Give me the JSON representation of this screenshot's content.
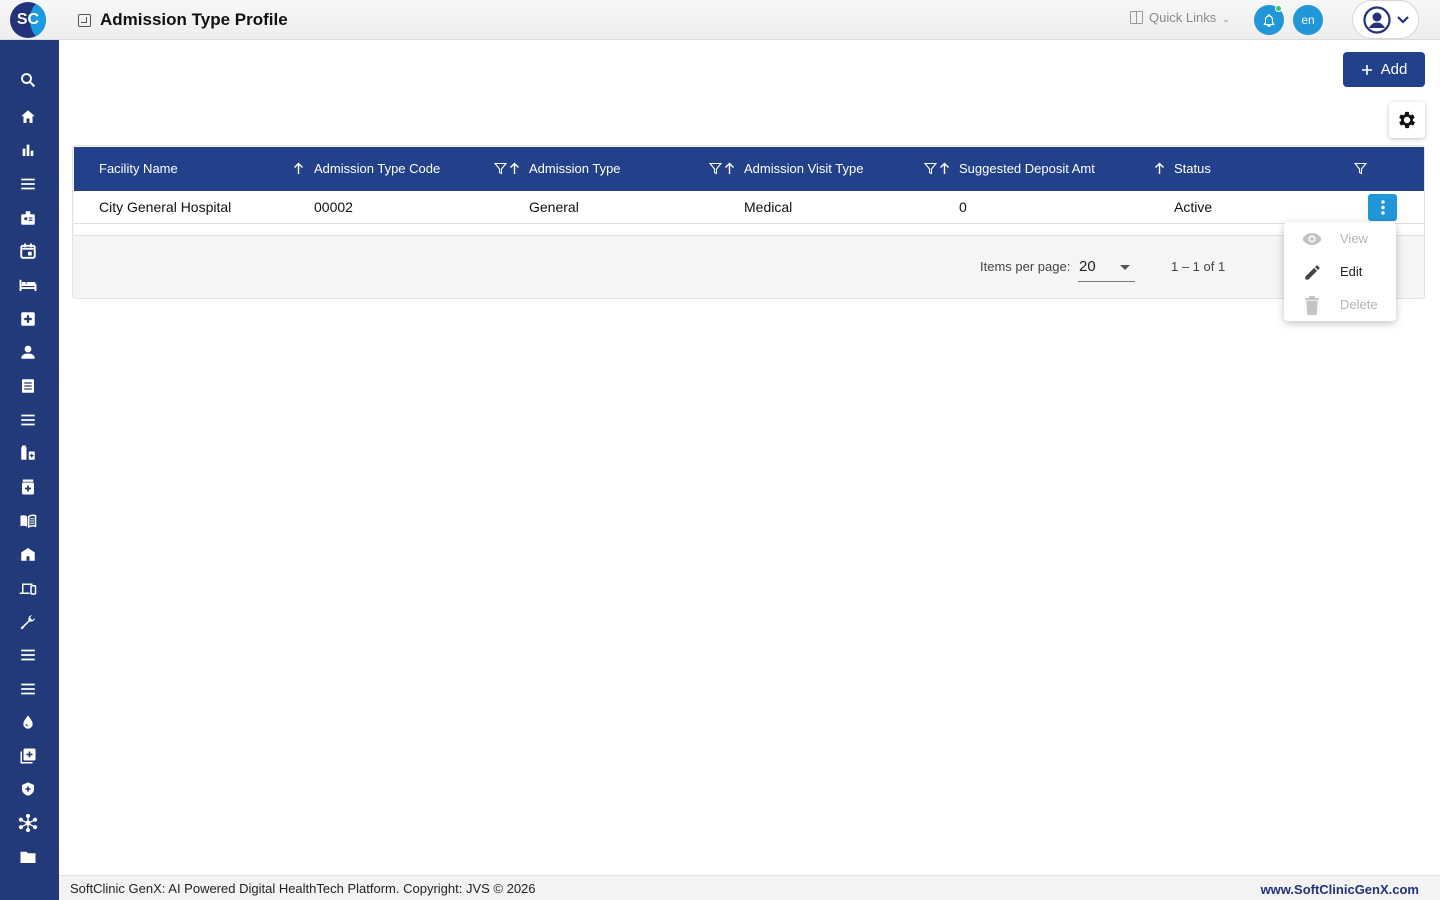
{
  "header": {
    "logo_s": "S",
    "logo_c": "C",
    "title": "Admission Type Profile",
    "quick_links": "Quick Links",
    "language": "en"
  },
  "toolbar": {
    "add_label": "Add"
  },
  "table": {
    "columns": [
      "Facility Name",
      "Admission Type Code",
      "Admission Type",
      "Admission Visit Type",
      "Suggested Deposit Amt",
      "Status"
    ],
    "rows": [
      [
        "City General Hospital",
        "00002",
        "General",
        "Medical",
        "0",
        "Active"
      ]
    ]
  },
  "pagination": {
    "items_per_page_label": "Items per page:",
    "items_per_page_value": "20",
    "range": "1 – 1 of 1"
  },
  "row_menu": {
    "view": "View",
    "edit": "Edit",
    "delete": "Delete"
  },
  "footer": {
    "copyright": "SoftClinic GenX: AI Powered Digital HealthTech Platform. Copyright: JVS © 2026",
    "website": "www.SoftClinicGenX.com"
  },
  "colors": {
    "sidebar": "#233a7a",
    "header_table": "#23418a",
    "accent": "#2196d8"
  }
}
